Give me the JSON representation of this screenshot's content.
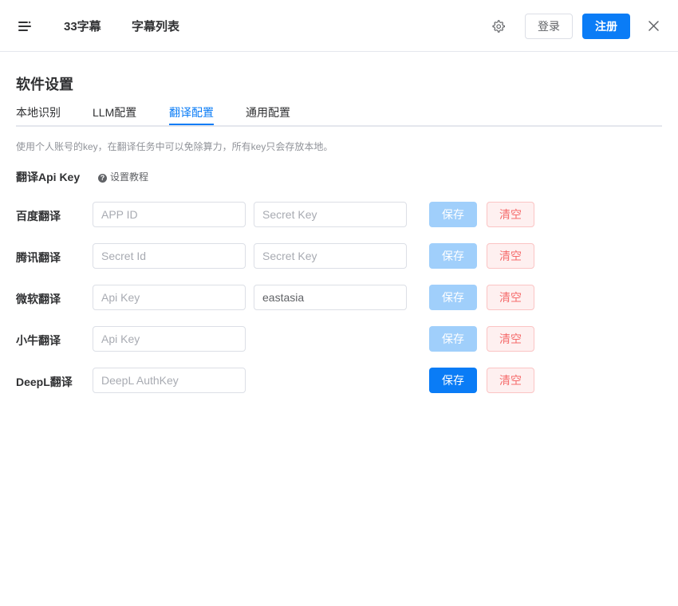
{
  "header": {
    "nav": [
      "33字幕",
      "字幕列表"
    ],
    "login_label": "登录",
    "register_label": "注册",
    "icons": [
      "menu-icon",
      "gear-icon",
      "close-icon"
    ]
  },
  "page": {
    "title": "软件设置",
    "tabs": [
      "本地识别",
      "LLM配置",
      "翻译配置",
      "通用配置"
    ],
    "active_tab": "翻译配置",
    "hint": "使用个人账号的key，在翻译任务中可以免除算力，所有key只会存放本地。",
    "section_title": "翻译Api Key",
    "help_link": "设置教程"
  },
  "rows": [
    {
      "label": "百度翻译",
      "field1_placeholder": "APP ID",
      "field1_value": "",
      "field2_placeholder": "Secret Key",
      "field2_value": "",
      "save_label": "保存",
      "clear_label": "清空"
    },
    {
      "label": "腾讯翻译",
      "field1_placeholder": "Secret Id",
      "field1_value": "",
      "field2_placeholder": "Secret Key",
      "field2_value": "",
      "save_label": "保存",
      "clear_label": "清空"
    },
    {
      "label": "微软翻译",
      "field1_placeholder": "Api Key",
      "field1_value": "",
      "field2_placeholder": "",
      "field2_value": "eastasia",
      "save_label": "保存",
      "clear_label": "清空"
    },
    {
      "label": "小牛翻译",
      "field1_placeholder": "Api Key",
      "field1_value": "",
      "save_label": "保存",
      "clear_label": "清空"
    },
    {
      "label": "DeepL翻译",
      "field1_placeholder": "DeepL AuthKey",
      "field1_value": "",
      "save_label": "保存",
      "clear_label": "清空"
    }
  ],
  "colors": {
    "primary": "#0a7cf6",
    "primary_disabled": "#a0cffb",
    "danger_text": "#f56c6c",
    "danger_bg": "#fef0f0"
  }
}
